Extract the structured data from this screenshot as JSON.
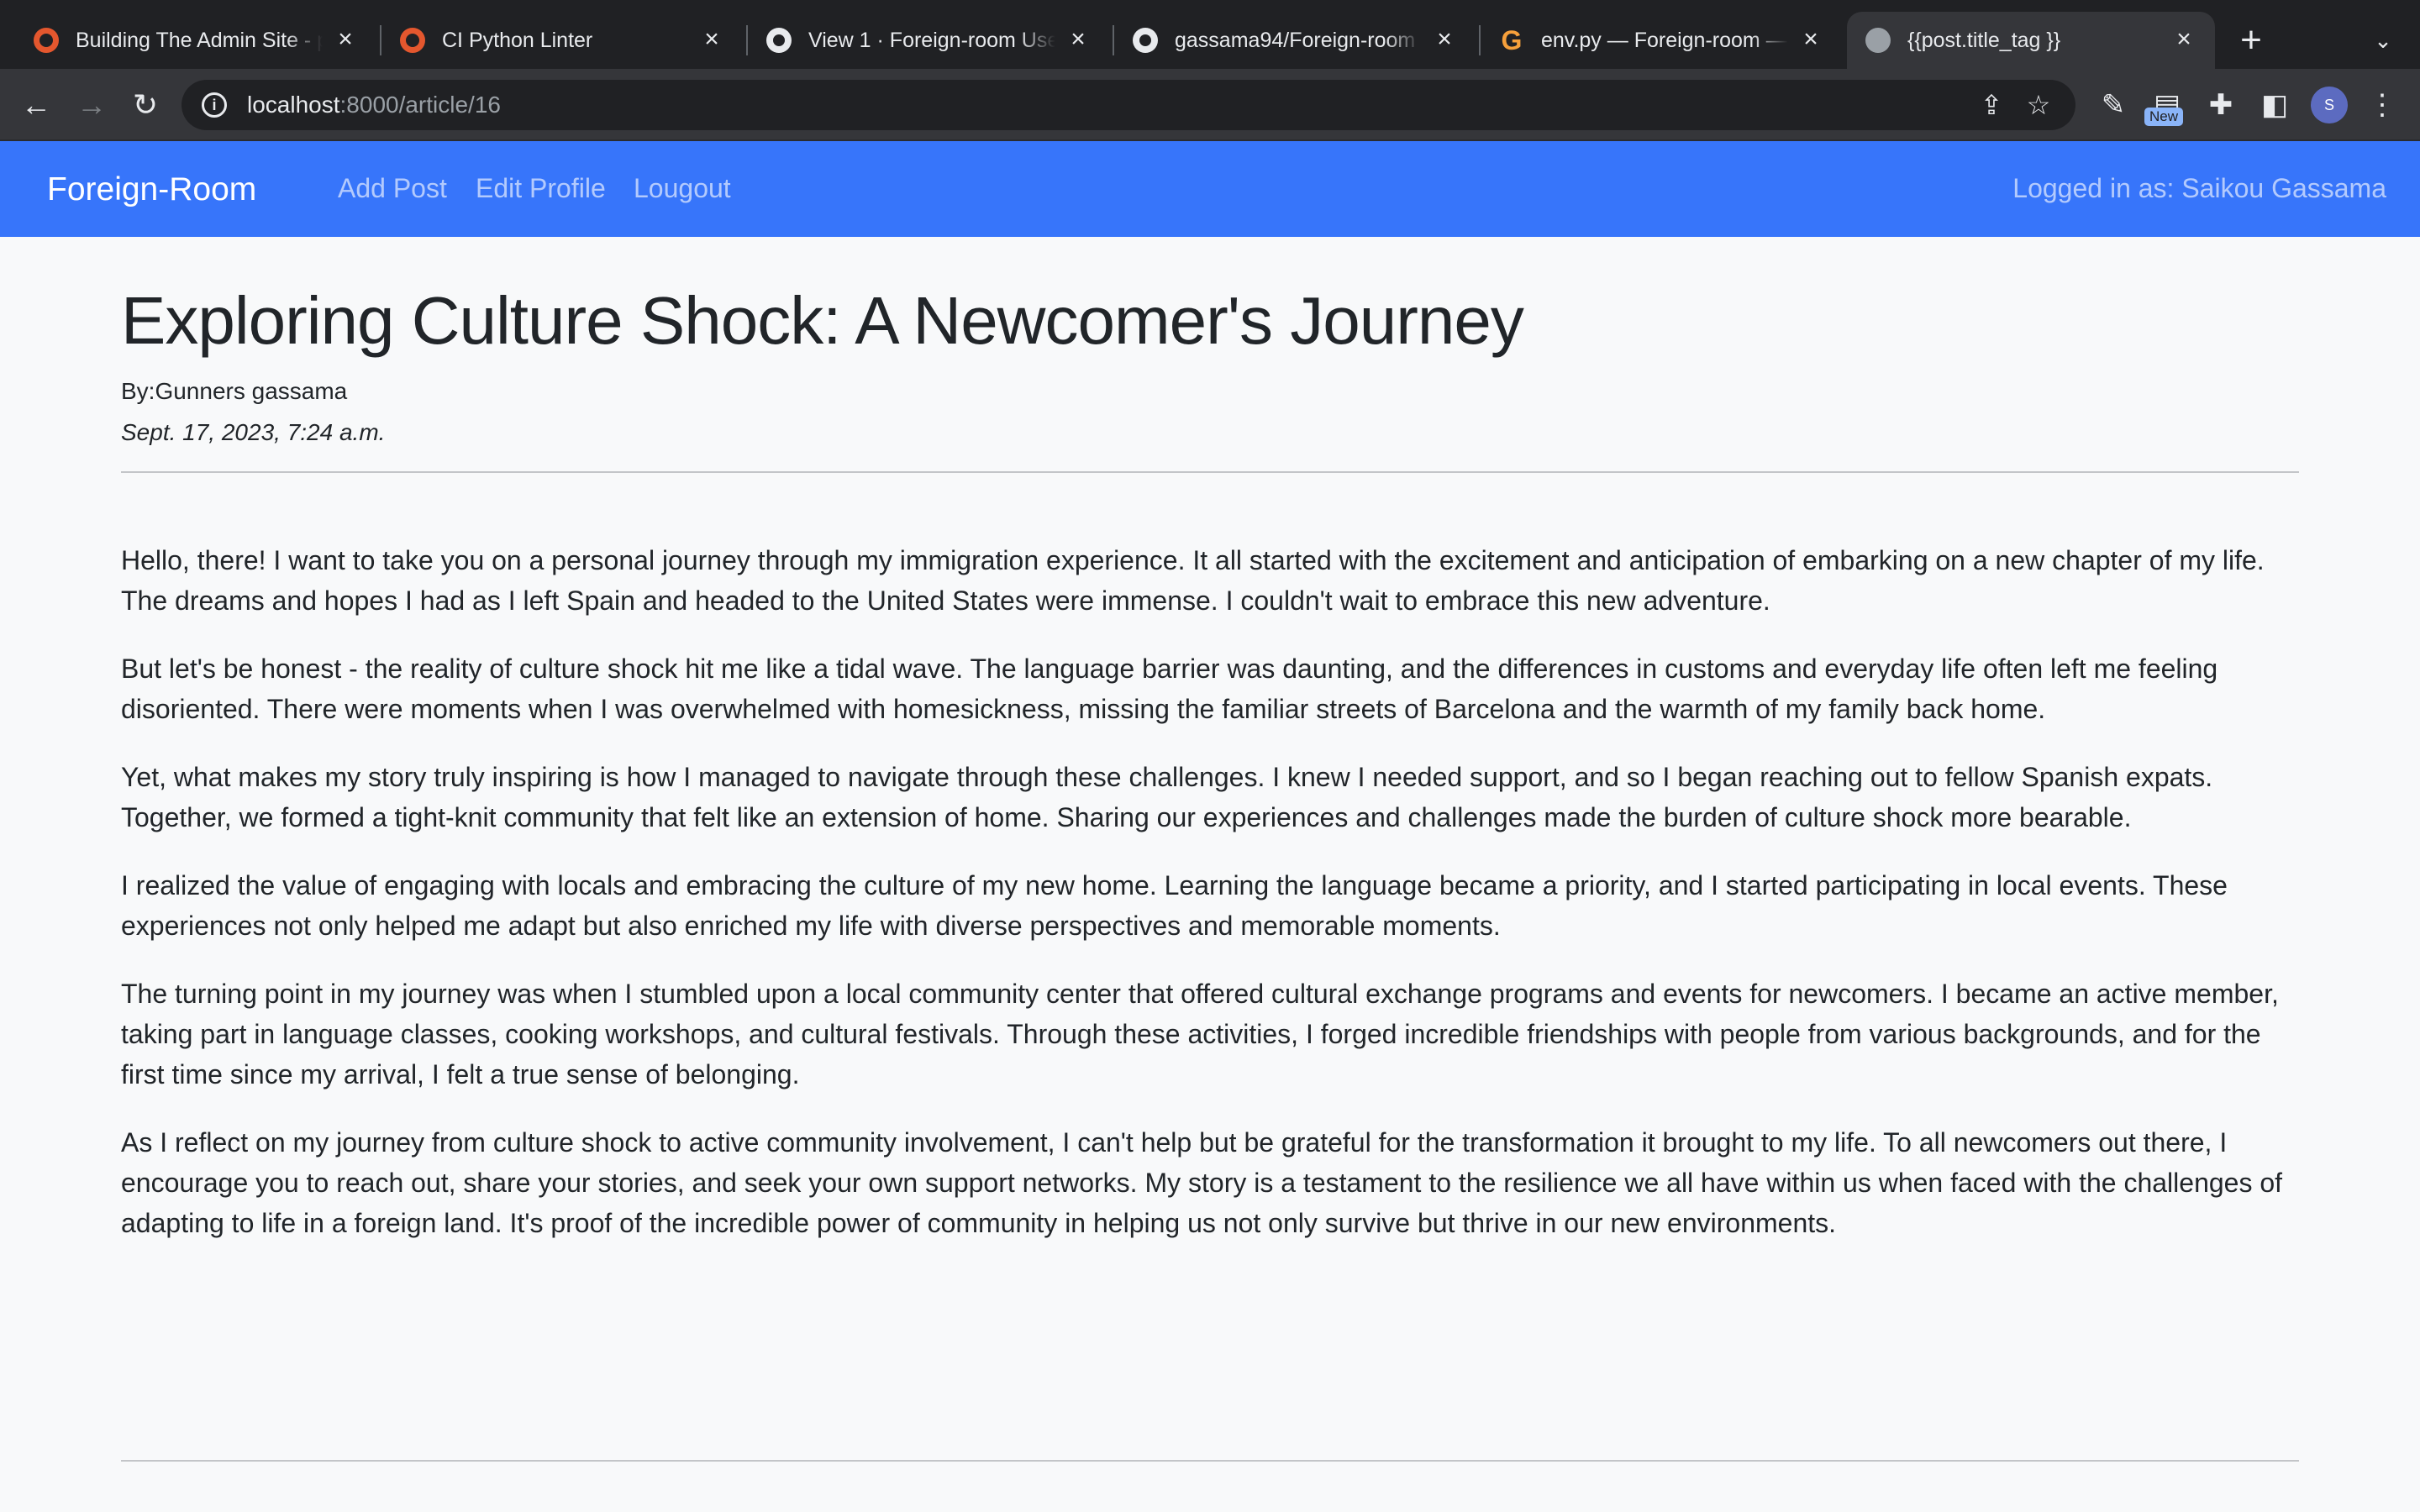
{
  "browser": {
    "tabs": [
      {
        "title": "Building The Admin Site - p",
        "icon": "circle-ring-icon"
      },
      {
        "title": "CI Python Linter",
        "icon": "circle-ring-icon"
      },
      {
        "title": "View 1 · Foreign-room User",
        "icon": "github-icon"
      },
      {
        "title": "gassama94/Foreign-room",
        "icon": "github-icon"
      },
      {
        "title": "env.py — Foreign-room — C",
        "icon": "gitpod-icon"
      },
      {
        "title": "{{post.title_tag }}",
        "icon": "globe-icon"
      }
    ],
    "url_host": "localhost",
    "url_path": ":8000/article/16",
    "new_badge": "New",
    "avatar_letter": "S"
  },
  "navbar": {
    "brand": "Foreign-Room",
    "links": [
      "Add Post",
      "Edit Profile",
      "Lougout"
    ],
    "logged_in": "Logged in as: Saikou Gassama",
    "color": "#3775fa"
  },
  "article": {
    "title": "Exploring Culture Shock: A Newcomer's Journey",
    "author": "By:Gunners gassama",
    "date": "Sept. 17, 2023, 7:24 a.m.",
    "paragraphs": [
      "Hello, there! I want to take you on a personal journey through my immigration experience. It all started with the excitement and anticipation of embarking on a new chapter of my life. The dreams and hopes I had as I left Spain and headed to the United States were immense. I couldn't wait to embrace this new adventure.",
      "But let's be honest - the reality of culture shock hit me like a tidal wave. The language barrier was daunting, and the differences in customs and everyday life often left me feeling disoriented. There were moments when I was overwhelmed with homesickness, missing the familiar streets of Barcelona and the warmth of my family back home.",
      "Yet, what makes my story truly inspiring is how I managed to navigate through these challenges. I knew I needed support, and so I began reaching out to fellow Spanish expats. Together, we formed a tight-knit community that felt like an extension of home. Sharing our experiences and challenges made the burden of culture shock more bearable.",
      "I realized the value of engaging with locals and embracing the culture of my new home. Learning the language became a priority, and I started participating in local events. These experiences not only helped me adapt but also enriched my life with diverse perspectives and memorable moments.",
      "The turning point in my journey was when I stumbled upon a local community center that offered cultural exchange programs and events for newcomers. I became an active member, taking part in language classes, cooking workshops, and cultural festivals. Through these activities, I forged incredible friendships with people from various backgrounds, and for the first time since my arrival, I felt a true sense of belonging.",
      "As I reflect on my journey from culture shock to active community involvement, I can't help but be grateful for the transformation it brought to my life. To all newcomers out there, I encourage you to reach out, share your stories, and seek your own support networks. My story is a testament to the resilience we all have within us when faced with the challenges of adapting to life in a foreign land. It's proof of the incredible power of community in helping us not only survive but thrive in our new environments."
    ]
  }
}
